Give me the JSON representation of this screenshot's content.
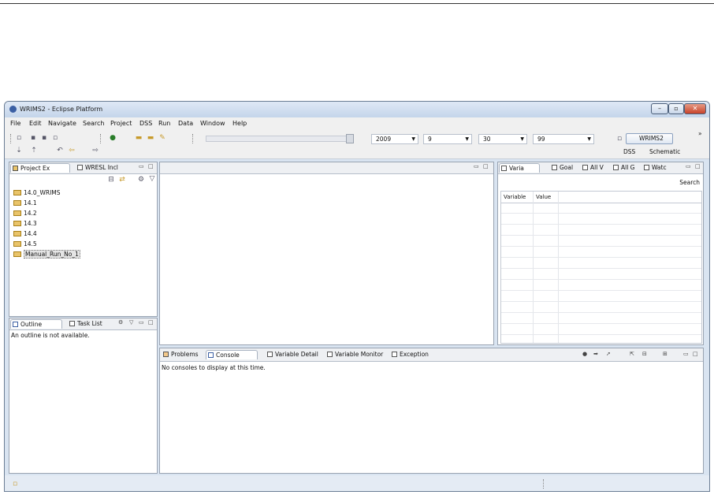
{
  "window": {
    "title": "WRIMS2 - Eclipse Platform"
  },
  "window_buttons": {
    "minimize": "–",
    "maximize": "▫",
    "close": "✕"
  },
  "menu": [
    "File",
    "Edit",
    "Navigate",
    "Search",
    "Project",
    "DSS",
    "Run",
    "Data",
    "Window",
    "Help"
  ],
  "toolbar": {
    "combos": [
      {
        "name": "year",
        "value": "2009"
      },
      {
        "name": "month",
        "value": "9"
      },
      {
        "name": "day",
        "value": "30"
      },
      {
        "name": "cycle",
        "value": "99"
      }
    ],
    "perspective": {
      "active": "WRIMS2",
      "others": [
        "DSS",
        "Schematic"
      ]
    },
    "overflow": "»"
  },
  "project_explorer": {
    "tabs": [
      "Project Ex",
      "WRESL Incl"
    ],
    "items": [
      "14.0_WRIMS",
      "14.1",
      "14.2",
      "14.3",
      "14.4",
      "14.5",
      "Manual_Run_No_1"
    ],
    "selected": "Manual_Run_No_1"
  },
  "outline": {
    "tabs": [
      "Outline",
      "Task List"
    ],
    "message": "An outline is not available."
  },
  "variables_view": {
    "tabs": [
      "Varia",
      "Goal",
      "All V",
      "All G",
      "Watc"
    ],
    "search_label": "Search",
    "columns": [
      "Variable",
      "Value"
    ]
  },
  "bottom_panel": {
    "tabs": [
      "Problems",
      "Console",
      "Variable Detail",
      "Variable Monitor",
      "Exception"
    ],
    "active_tab": "Console",
    "message": "No consoles to display at this time."
  },
  "colors": {
    "title_bar": "#c4d5ea",
    "window_frame": "#d9e4f1",
    "close_button": "#c8432a",
    "folder": "#e9c46a"
  }
}
